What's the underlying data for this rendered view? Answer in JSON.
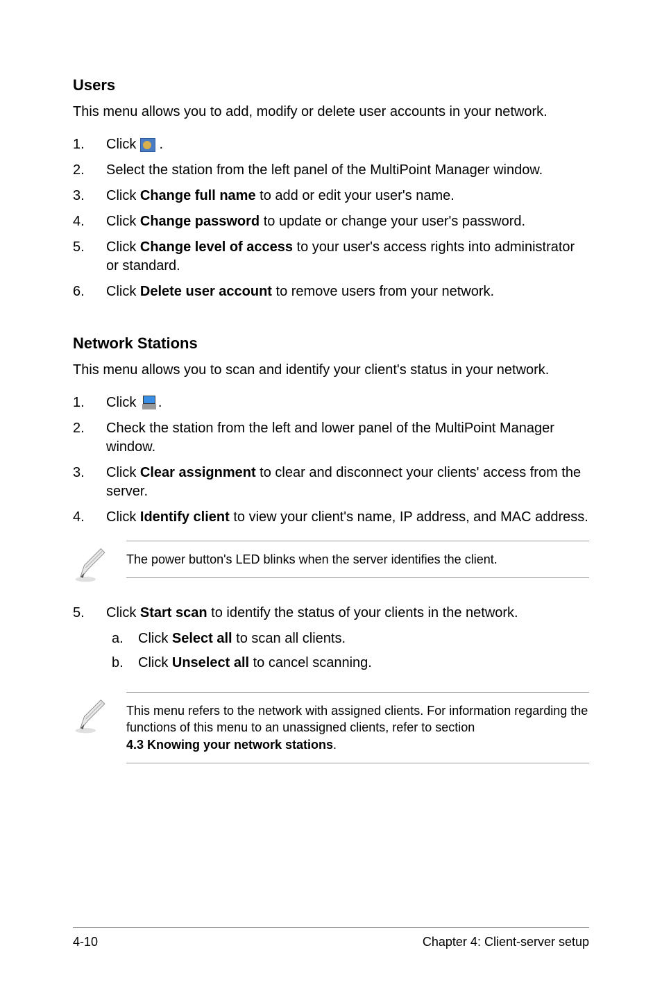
{
  "users": {
    "heading": "Users",
    "intro": "This menu allows you to add, modify or delete user accounts in your network.",
    "items": [
      {
        "num": "1.",
        "pre": "Click ",
        "icon": "users",
        "post": " ."
      },
      {
        "num": "2.",
        "text": "Select the station from the left panel of the MultiPoint Manager window."
      },
      {
        "num": "3.",
        "pre": "Click ",
        "bold": "Change full name",
        "post": " to add or edit your user's name."
      },
      {
        "num": "4.",
        "pre": "Click ",
        "bold": "Change password",
        "post": " to update or change your user's password."
      },
      {
        "num": "5.",
        "pre": "Click ",
        "bold": "Change level of access",
        "post": " to your user's access rights into administrator or standard."
      },
      {
        "num": "6.",
        "pre": "Click ",
        "bold": "Delete user account",
        "post": " to remove users from your network."
      }
    ]
  },
  "network": {
    "heading": "Network Stations",
    "intro": "This menu allows you to scan and identify your client's status in your network.",
    "items": [
      {
        "num": "1.",
        "pre": "Click ",
        "icon": "monitors",
        "post": "."
      },
      {
        "num": "2.",
        "text": "Check the station from the left and lower panel of the MultiPoint Manager window."
      },
      {
        "num": "3.",
        "pre": "Click ",
        "bold": "Clear assignment",
        "post": " to clear and disconnect your clients' access from the server."
      },
      {
        "num": "4.",
        "pre": "Click ",
        "bold": "Identify client",
        "post": " to view your client's name, IP address, and MAC address."
      }
    ],
    "note1": "The power button's LED blinks when the server identifies the client.",
    "items2": [
      {
        "num": "5.",
        "pre": "Click ",
        "bold": "Start scan",
        "post": " to identify the status of your clients in the network.",
        "subs": [
          {
            "num": "a.",
            "pre": "Click ",
            "bold": "Select all",
            "post": " to scan all clients."
          },
          {
            "num": "b.",
            "pre": "Click ",
            "bold": "Unselect all",
            "post": " to cancel scanning."
          }
        ]
      }
    ],
    "note2_pre": "This menu refers to the network with assigned clients. For information regarding the functions of this menu to an unassigned clients, refer to section ",
    "note2_bold": "4.3 Knowing your network stations",
    "note2_post": "."
  },
  "footer": {
    "left": "4-10",
    "right": "Chapter 4: Client-server setup"
  }
}
